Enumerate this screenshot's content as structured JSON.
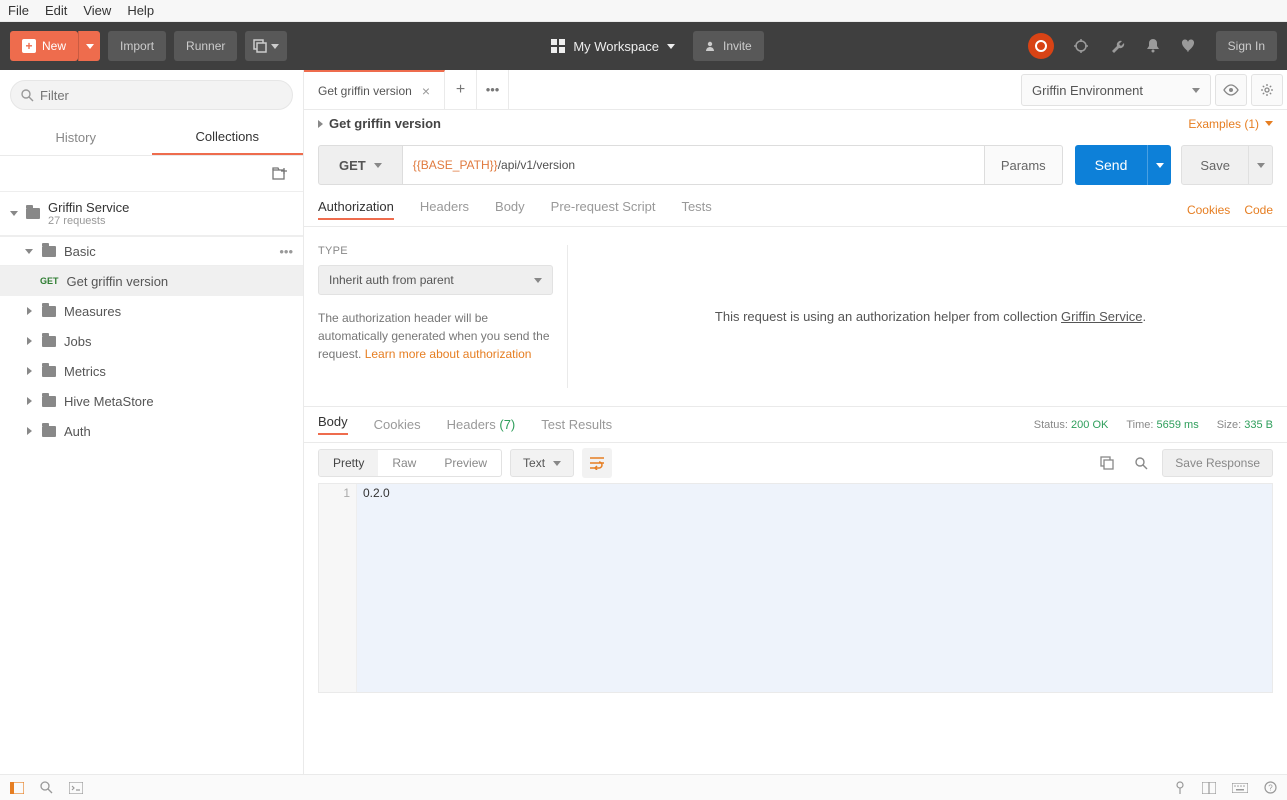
{
  "menubar": [
    "File",
    "Edit",
    "View",
    "Help"
  ],
  "toolbar": {
    "new": "New",
    "import": "Import",
    "runner": "Runner",
    "workspace": "My Workspace",
    "invite": "Invite",
    "signin": "Sign In"
  },
  "sidebar": {
    "filter_placeholder": "Filter",
    "tabs": {
      "history": "History",
      "collections": "Collections"
    },
    "collection": {
      "name": "Griffin Service",
      "requests": "27 requests"
    },
    "folders": [
      {
        "name": "Basic",
        "expanded": true,
        "items": [
          {
            "method": "GET",
            "name": "Get griffin version"
          }
        ]
      },
      {
        "name": "Measures",
        "expanded": false
      },
      {
        "name": "Jobs",
        "expanded": false
      },
      {
        "name": "Metrics",
        "expanded": false
      },
      {
        "name": "Hive MetaStore",
        "expanded": false
      },
      {
        "name": "Auth",
        "expanded": false
      }
    ]
  },
  "tabs": {
    "active": "Get griffin version"
  },
  "env": {
    "selected": "Griffin Environment"
  },
  "request": {
    "title": "Get griffin version",
    "examples": "Examples (1)",
    "method": "GET",
    "url_var": "{{BASE_PATH}}",
    "url_path": "/api/v1/version",
    "params": "Params",
    "send": "Send",
    "save": "Save",
    "tabs": [
      "Authorization",
      "Headers",
      "Body",
      "Pre-request Script",
      "Tests"
    ],
    "right_links": {
      "cookies": "Cookies",
      "code": "Code"
    }
  },
  "auth": {
    "type_label": "TYPE",
    "type_value": "Inherit auth from parent",
    "note_pre": "The authorization header will be automatically generated when you send the request. ",
    "note_link": "Learn more about authorization",
    "helper_pre": "This request is using an authorization helper from collection ",
    "helper_coll": "Griffin Service",
    "helper_post": "."
  },
  "response": {
    "tabs": {
      "body": "Body",
      "cookies": "Cookies",
      "headers": "Headers",
      "headers_count": "(7)",
      "tests": "Test Results"
    },
    "status_label": "Status:",
    "status": "200 OK",
    "time_label": "Time:",
    "time": "5659 ms",
    "size_label": "Size:",
    "size": "335 B",
    "view": {
      "pretty": "Pretty",
      "raw": "Raw",
      "preview": "Preview",
      "format": "Text"
    },
    "save": "Save Response",
    "line_no": "1",
    "body": "0.2.0"
  }
}
